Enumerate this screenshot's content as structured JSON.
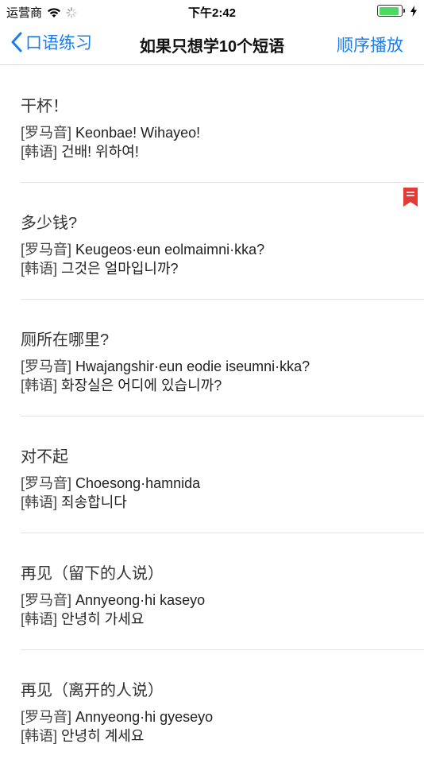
{
  "status": {
    "carrier": "运营商",
    "time": "下午2:42",
    "battery_level": 0.9
  },
  "nav": {
    "back_label": "口语练习",
    "title": "如果只想学10个短语",
    "action_label": "顺序播放"
  },
  "tags": {
    "roman": "[罗马音]",
    "korean": "[韩语]"
  },
  "phrases": [
    {
      "cn": "干杯！",
      "roman": "Keonbae! Wihayeo!",
      "korean": "건배! 위하여!",
      "bookmarked": false
    },
    {
      "cn": "多少钱?",
      "roman": "Keugeos·eun eolmaimni·kka?",
      "korean": "그것은 얼마입니까?",
      "bookmarked": true
    },
    {
      "cn": "厕所在哪里?",
      "roman": "Hwajangshir·eun eodie iseumni·kka?",
      "korean": "화장실은 어디에 있습니까?",
      "bookmarked": false
    },
    {
      "cn": "对不起",
      "roman": "Choesong·hamnida",
      "korean": "죄송합니다",
      "bookmarked": false
    },
    {
      "cn": "再见（留下的人说）",
      "roman": "Annyeong·hi kaseyo",
      "korean": "안녕히 가세요",
      "bookmarked": false
    },
    {
      "cn": "再见（离开的人说）",
      "roman": "Annyeong·hi gyeseyo",
      "korean": "안녕히 계세요",
      "bookmarked": false
    }
  ],
  "colors": {
    "accent": "#1a7ef2",
    "bookmark": "#e53935",
    "battery": "#4cd964"
  }
}
